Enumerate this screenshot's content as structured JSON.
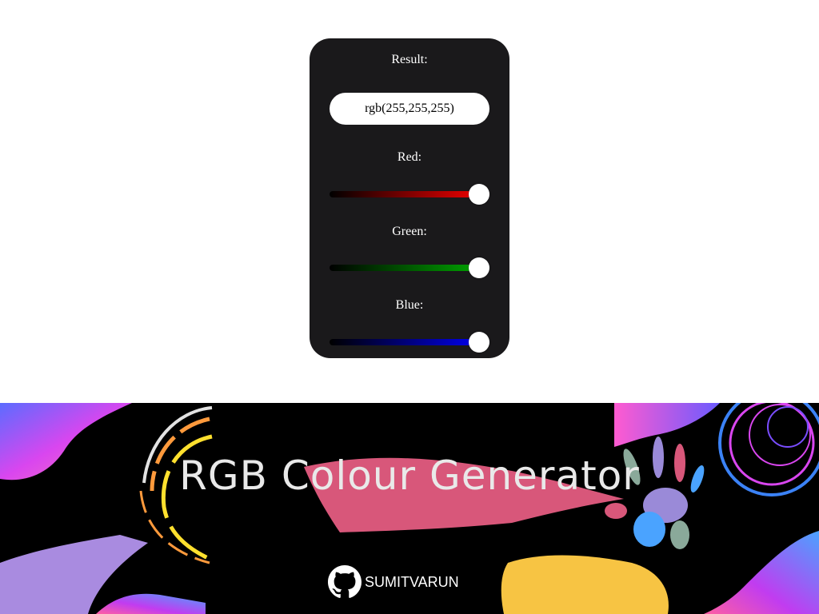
{
  "generator": {
    "result_label": "Result:",
    "result_value": "rgb(255,255,255)",
    "sliders": [
      {
        "label": "Red:",
        "value": 255,
        "max": 255,
        "color": "#ff0000"
      },
      {
        "label": "Green:",
        "value": 255,
        "max": 255,
        "color": "#00b000"
      },
      {
        "label": "Blue:",
        "value": 255,
        "max": 255,
        "color": "#0000ff"
      }
    ]
  },
  "banner": {
    "title": "RGB Colour Generator",
    "github_user": "SUMITVARUN"
  }
}
